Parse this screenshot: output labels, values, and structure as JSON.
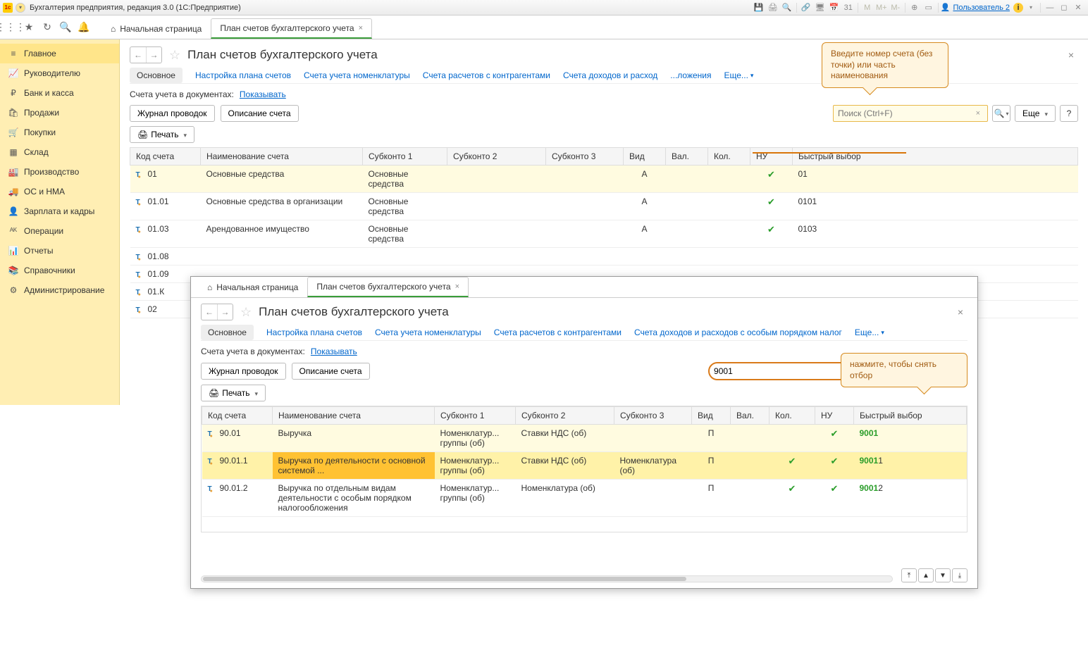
{
  "app": {
    "title": "Бухгалтерия предприятия, редакция 3.0  (1С:Предприятие)",
    "user": "Пользователь 2"
  },
  "titlebar_icons": {
    "m1": "M",
    "m2": "M+",
    "m3": "M-"
  },
  "toptabs": {
    "home": "Начальная страница",
    "plan": "План счетов бухгалтерского учета"
  },
  "sidebar": [
    {
      "icon": "≡",
      "label": "Главное"
    },
    {
      "icon": "📈",
      "label": "Руководителю"
    },
    {
      "icon": "₽",
      "label": "Банк и касса"
    },
    {
      "icon": "🛍",
      "label": "Продажи"
    },
    {
      "icon": "🛒",
      "label": "Покупки"
    },
    {
      "icon": "▦",
      "label": "Склад"
    },
    {
      "icon": "🏭",
      "label": "Производство"
    },
    {
      "icon": "🚚",
      "label": "ОС и НМА"
    },
    {
      "icon": "👤",
      "label": "Зарплата и кадры"
    },
    {
      "icon": "ᴬᴷ",
      "label": "Операции"
    },
    {
      "icon": "📊",
      "label": "Отчеты"
    },
    {
      "icon": "📚",
      "label": "Справочники"
    },
    {
      "icon": "⚙",
      "label": "Администрирование"
    }
  ],
  "page": {
    "title": "План счетов бухгалтерского учета",
    "tabs": [
      "Основное",
      "Настройка плана счетов",
      "Счета учета номенклатуры",
      "Счета расчетов с контрагентами",
      "Счета доходов и расход"
    ],
    "tabs_more_partial": "ложения",
    "more": "Еще...",
    "filter_label": "Счета учета в документах:",
    "filter_value": "Показывать",
    "btn_journal": "Журнал проводок",
    "btn_desc": "Описание счета",
    "btn_print": "Печать",
    "search_placeholder": "Поиск (Ctrl+F)",
    "btn_more": "Еще",
    "btn_help": "?",
    "callout1": "Введите номер счета (без точки) или часть наименования"
  },
  "columns": [
    "Код счета",
    "Наименование счета",
    "Субконто 1",
    "Субконто 2",
    "Субконто 3",
    "Вид",
    "Вал.",
    "Кол.",
    "НУ",
    "Быстрый выбор"
  ],
  "rows1": [
    {
      "code": "01",
      "name": "Основные средства",
      "s1": "Основные средства",
      "vid": "А",
      "nu": true,
      "qs": "01"
    },
    {
      "code": "01.01",
      "name": "Основные средства в организации",
      "s1": "Основные средства",
      "vid": "А",
      "nu": true,
      "qs": "0101"
    },
    {
      "code": "01.03",
      "name": "Арендованное имущество",
      "s1": "Основные средства",
      "vid": "А",
      "nu": true,
      "qs": "0103"
    },
    {
      "code": "01.08",
      "name": "",
      "s1": "",
      "vid": "",
      "nu": false,
      "qs": ""
    },
    {
      "code": "01.09",
      "name": "",
      "s1": "",
      "vid": "",
      "nu": false,
      "qs": ""
    },
    {
      "code": "01.К",
      "name": "",
      "s1": "",
      "vid": "",
      "nu": false,
      "qs": ""
    },
    {
      "code": "02",
      "name": "",
      "s1": "",
      "vid": "",
      "nu": false,
      "qs": ""
    }
  ],
  "win2": {
    "title": "План счетов бухгалтерского учета",
    "tabs": [
      "Основное",
      "Настройка плана счетов",
      "Счета учета номенклатуры",
      "Счета расчетов с контрагентами",
      "Счета доходов и расходов с особым порядком налог"
    ],
    "search_value": "9001",
    "callout": "нажмите, чтобы снять отбор",
    "rows": [
      {
        "code": "90.01",
        "name": "Выручка",
        "s1": "Номенклатур... группы (об)",
        "s2": "Ставки НДС (об)",
        "s3": "",
        "vid": "П",
        "kol": false,
        "nu": true,
        "qs": "9001",
        "qs_tail": ""
      },
      {
        "code": "90.01.1",
        "name": "Выручка по деятельности с основной системой ...",
        "s1": "Номенклатур... группы (об)",
        "s2": "Ставки НДС (об)",
        "s3": "Номенклатура (об)",
        "vid": "П",
        "kol": true,
        "nu": true,
        "qs": "9001",
        "qs_tail": "1"
      },
      {
        "code": "90.01.2",
        "name": "Выручка по отдельным видам деятельности с особым порядком налогообложения",
        "s1": "Номенклатур... группы (об)",
        "s2": "Номенклатура (об)",
        "s3": "",
        "vid": "П",
        "kol": true,
        "nu": true,
        "qs": "9001",
        "qs_tail": "2"
      }
    ]
  }
}
